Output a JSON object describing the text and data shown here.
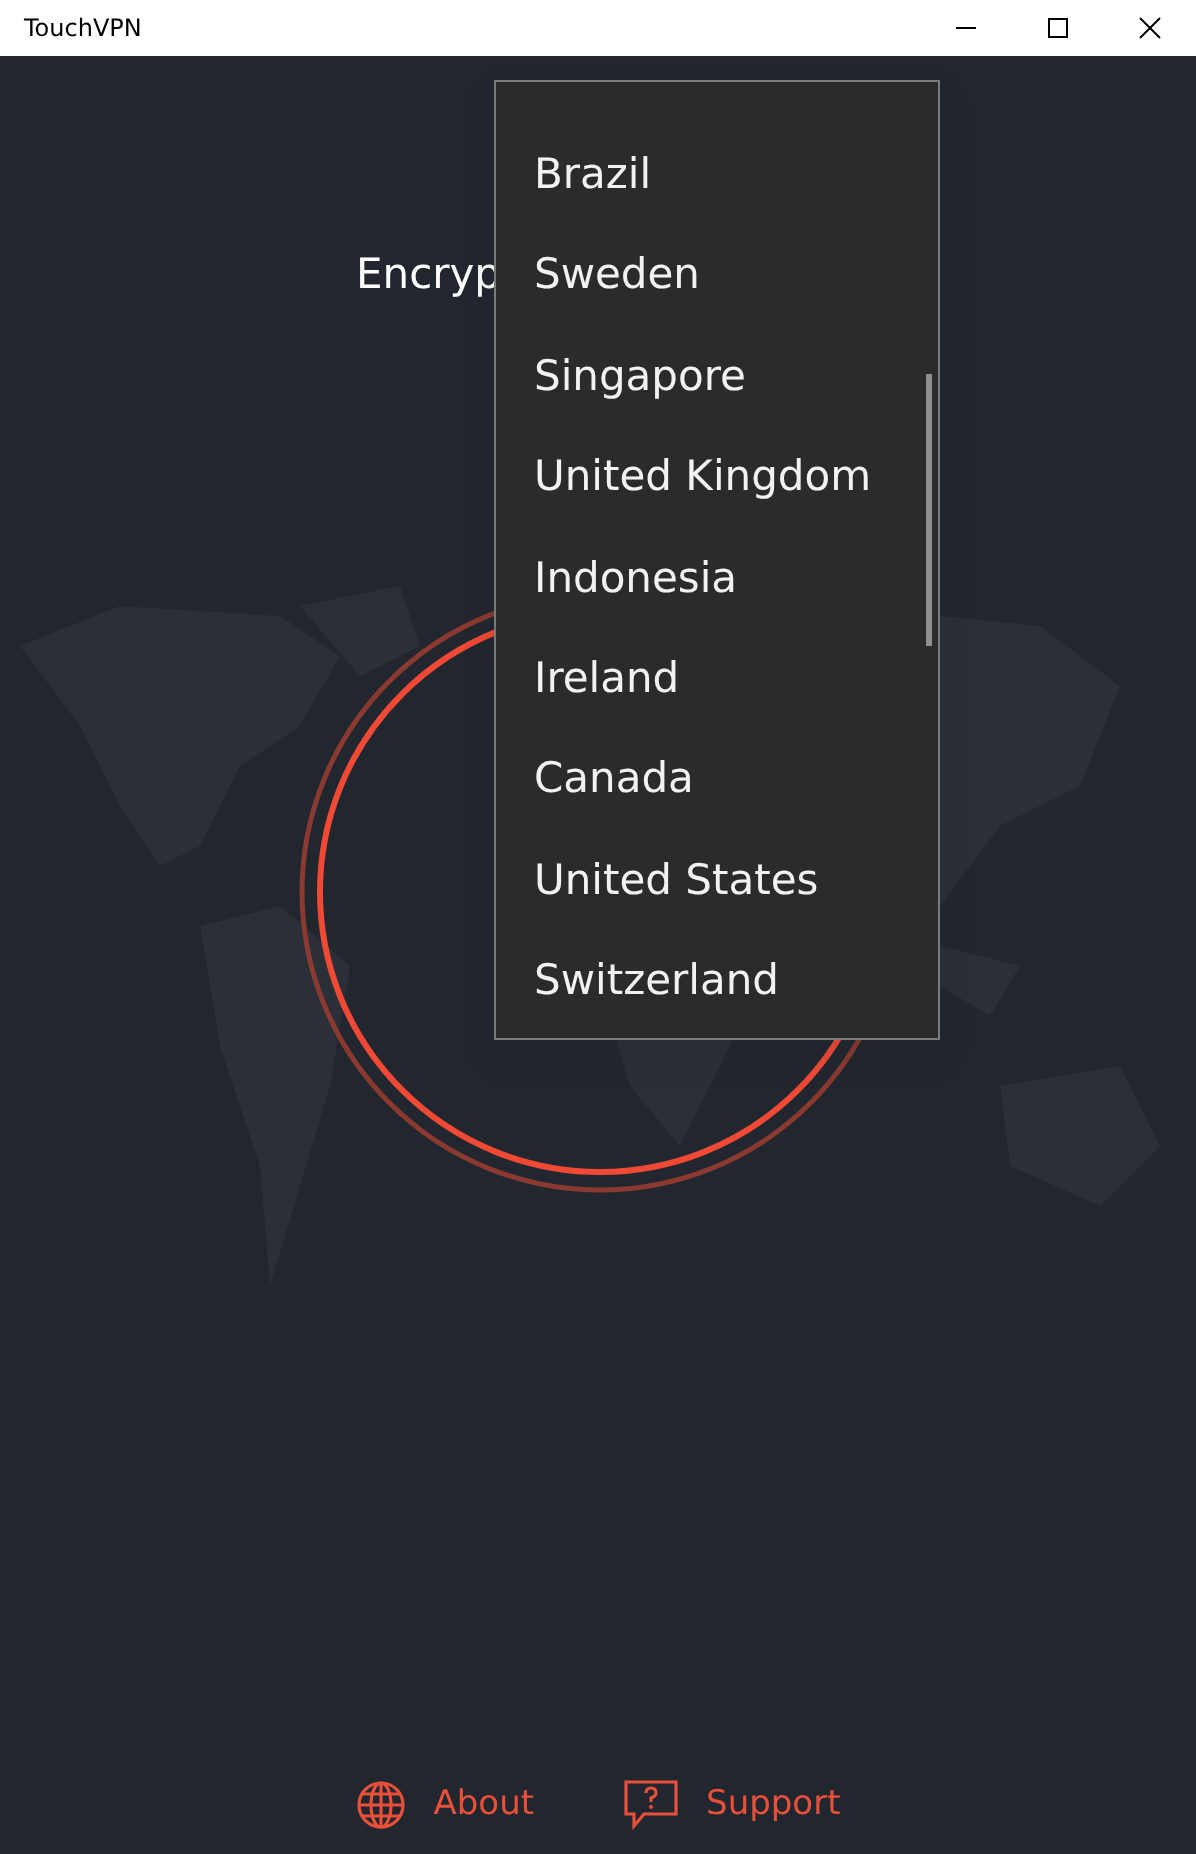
{
  "window": {
    "title": "TouchVPN"
  },
  "headline": "Encryp",
  "country_dropdown": {
    "items": [
      {
        "label": "Brazil"
      },
      {
        "label": "Sweden"
      },
      {
        "label": "Singapore"
      },
      {
        "label": "United Kingdom"
      },
      {
        "label": "Indonesia"
      },
      {
        "label": "Ireland"
      },
      {
        "label": "Canada"
      },
      {
        "label": "United States"
      },
      {
        "label": "Switzerland"
      }
    ]
  },
  "footer_links": [
    {
      "kind": "globe",
      "label": "About"
    },
    {
      "kind": "help",
      "label": "Support"
    }
  ]
}
